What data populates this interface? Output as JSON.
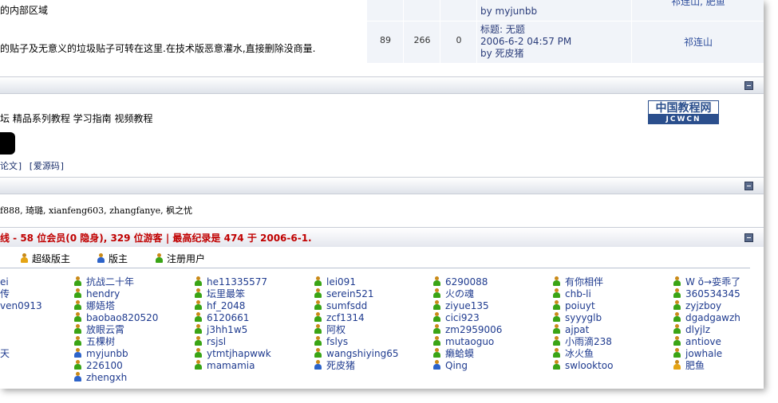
{
  "forums": [
    {
      "desc": "的内部区域",
      "threads": "",
      "posts": "",
      "today": "",
      "last_line1": "",
      "last_line2": "by myjunbb",
      "last_line3": "",
      "moderator": "祁连山, 肥鱼"
    },
    {
      "desc": "的贴子及无意义的垃圾贴子可转在这里.在技术版恶意灌水,直接删除没商量.",
      "threads": "89",
      "posts": "266",
      "today": "0",
      "last_line1": "标题: 无题",
      "last_line2": "2006-6-2 04:57 PM",
      "last_line3": "by 死皮猪",
      "moderator": "祁连山"
    }
  ],
  "links": {
    "text": "坛  精品系列教程  学习指南  视频教程",
    "small": "论文] [爱源码]",
    "logo_top": "中国教程网",
    "logo_bottom": "JCWCN"
  },
  "birthdays": "f888,  琦璐,  xianfeng603,  zhangfanye,  枫之忧",
  "online": {
    "summary": "线 - 58 位会员(0 隐身), 329 位游客 | 最高纪录是 474 于 2006-6-1."
  },
  "legend": {
    "super_mod": "超级版主",
    "mod": "版主",
    "member": "注册用户"
  },
  "users": [
    [
      {
        "name": "ei",
        "type": "none"
      },
      {
        "name": "传",
        "type": "none"
      },
      {
        "name": "ven0913",
        "type": "none"
      },
      {
        "name": "",
        "type": "none"
      },
      {
        "name": "",
        "type": "none"
      },
      {
        "name": "",
        "type": "none"
      },
      {
        "name": "天",
        "type": "none"
      }
    ],
    [
      {
        "name": "抗战二十年",
        "type": "green"
      },
      {
        "name": "hendry",
        "type": "green"
      },
      {
        "name": "娜娪塔",
        "type": "green"
      },
      {
        "name": "baobao820520",
        "type": "green"
      },
      {
        "name": "放眼云霄",
        "type": "green"
      },
      {
        "name": "五棵树",
        "type": "green"
      },
      {
        "name": "myjunbb",
        "type": "blue"
      },
      {
        "name": "226100",
        "type": "green"
      },
      {
        "name": "zhengxh",
        "type": "blue"
      }
    ],
    [
      {
        "name": "he11335577",
        "type": "green"
      },
      {
        "name": "坛里最笨",
        "type": "green"
      },
      {
        "name": "hf_2048",
        "type": "green"
      },
      {
        "name": "6120661",
        "type": "green"
      },
      {
        "name": "j3hh1w5",
        "type": "green"
      },
      {
        "name": "rsjsl",
        "type": "green"
      },
      {
        "name": "ytmtjhapwwk",
        "type": "green"
      },
      {
        "name": "mamamia",
        "type": "green"
      }
    ],
    [
      {
        "name": "lei091",
        "type": "green"
      },
      {
        "name": "serein521",
        "type": "green"
      },
      {
        "name": "sumfsdd",
        "type": "green"
      },
      {
        "name": "zcf1314",
        "type": "green"
      },
      {
        "name": "阿权",
        "type": "green"
      },
      {
        "name": "fslys",
        "type": "green"
      },
      {
        "name": "wangshiying65",
        "type": "green"
      },
      {
        "name": "死皮猪",
        "type": "blue"
      }
    ],
    [
      {
        "name": "6290088",
        "type": "green"
      },
      {
        "name": "火の魂",
        "type": "green"
      },
      {
        "name": "ziyue135",
        "type": "green"
      },
      {
        "name": "cici923",
        "type": "green"
      },
      {
        "name": "zm2959006",
        "type": "green"
      },
      {
        "name": "mutaoguo",
        "type": "green"
      },
      {
        "name": "癞蛤蟆",
        "type": "green"
      },
      {
        "name": "Qing",
        "type": "blue"
      }
    ],
    [
      {
        "name": "有你相伴",
        "type": "green"
      },
      {
        "name": "chb-li",
        "type": "green"
      },
      {
        "name": "poiuyt",
        "type": "green"
      },
      {
        "name": "syyyglb",
        "type": "green"
      },
      {
        "name": "ajpat",
        "type": "green"
      },
      {
        "name": "小雨滴238",
        "type": "green"
      },
      {
        "name": "冰火鱼",
        "type": "green"
      },
      {
        "name": "swlooktoo",
        "type": "green"
      }
    ],
    [
      {
        "name": "W ŏ→娈乖了",
        "type": "green"
      },
      {
        "name": "360534345",
        "type": "green"
      },
      {
        "name": "zyjzboy",
        "type": "green"
      },
      {
        "name": "dgadgawzh",
        "type": "green"
      },
      {
        "name": "dlyjlz",
        "type": "green"
      },
      {
        "name": "antiove",
        "type": "green"
      },
      {
        "name": "jowhale",
        "type": "green"
      },
      {
        "name": "肥鱼",
        "type": "yellow"
      }
    ]
  ]
}
